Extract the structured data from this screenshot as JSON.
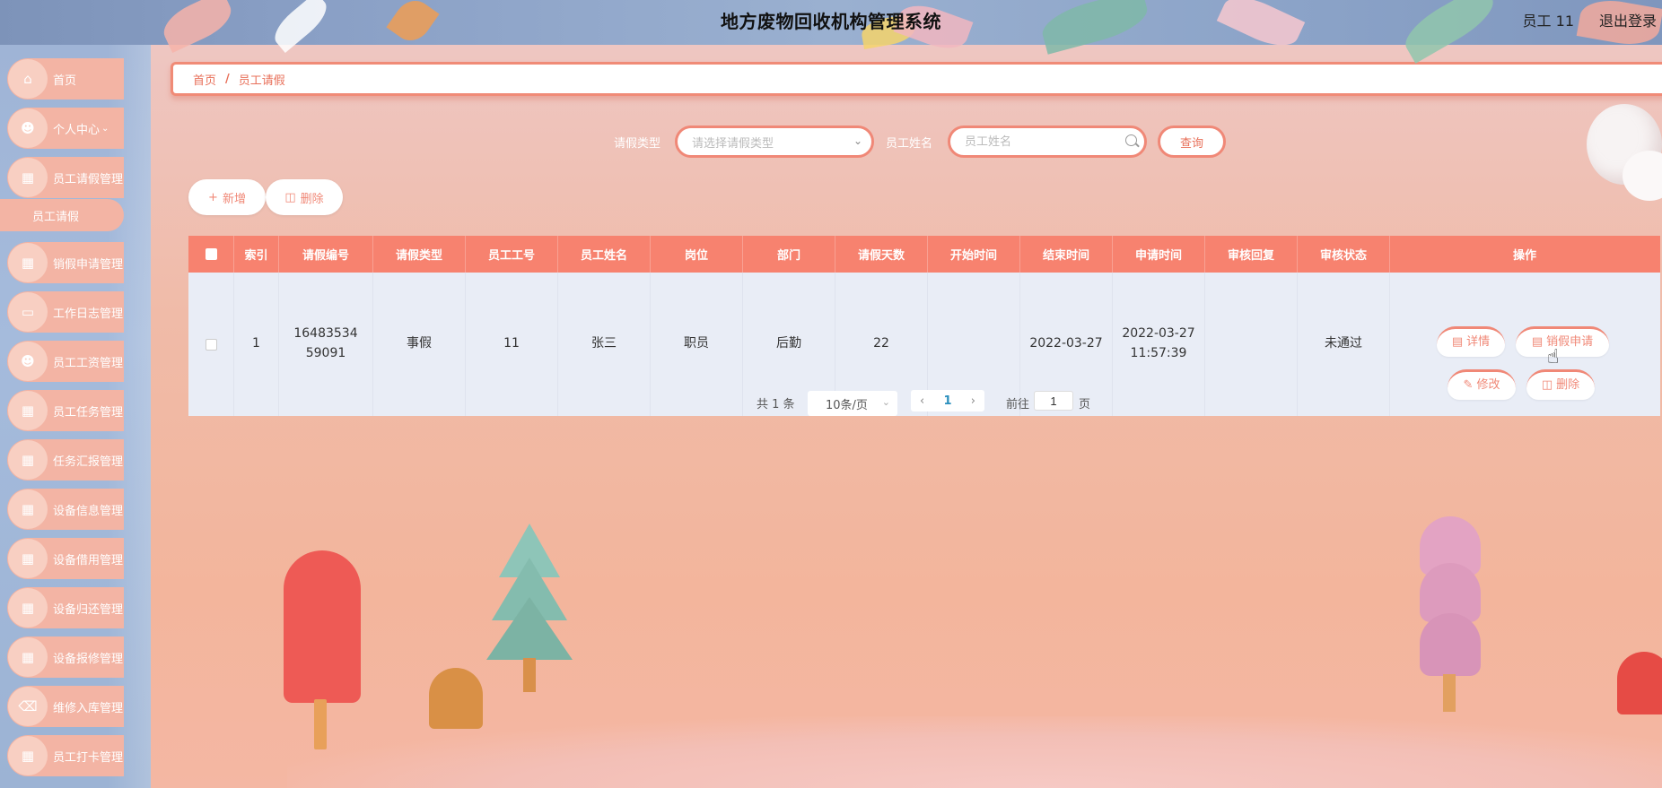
{
  "header": {
    "title": "地方废物回收机构管理系统",
    "user": "员工 11",
    "logout": "退出登录"
  },
  "sidebar": {
    "items": [
      {
        "label": "首页",
        "icon": "home-icon"
      },
      {
        "label": "个人中心",
        "icon": "user-icon"
      },
      {
        "label": "员工请假管理",
        "icon": "clipboard-icon"
      },
      {
        "label": "销假申请管理",
        "icon": "grid-icon"
      },
      {
        "label": "工作日志管理",
        "icon": "monitor-icon"
      },
      {
        "label": "员工工资管理",
        "icon": "user-icon"
      },
      {
        "label": "员工任务管理",
        "icon": "grid-icon"
      },
      {
        "label": "任务汇报管理",
        "icon": "grid-icon"
      },
      {
        "label": "设备信息管理",
        "icon": "grid-icon"
      },
      {
        "label": "设备借用管理",
        "icon": "clipboard-icon"
      },
      {
        "label": "设备归还管理",
        "icon": "grid-icon"
      },
      {
        "label": "设备报修管理",
        "icon": "grid-icon"
      },
      {
        "label": "维修入库管理",
        "icon": "ticket-icon"
      },
      {
        "label": "员工打卡管理",
        "icon": "grid-icon"
      }
    ],
    "sub_item": "员工请假"
  },
  "breadcrumb": {
    "home": "首页",
    "separator": "/",
    "current": "员工请假"
  },
  "search": {
    "type_label": "请假类型",
    "type_placeholder": "请选择请假类型",
    "name_label": "员工姓名",
    "name_placeholder": "员工姓名",
    "query_button": "查询"
  },
  "actions": {
    "add": "新增",
    "delete": "删除"
  },
  "table": {
    "columns": [
      "索引",
      "请假编号",
      "请假类型",
      "员工工号",
      "员工姓名",
      "岗位",
      "部门",
      "请假天数",
      "开始时间",
      "结束时间",
      "申请时间",
      "审核回复",
      "审核状态",
      "操作"
    ],
    "rows": [
      {
        "index": "1",
        "leave_no": "1648353459091",
        "leave_type": "事假",
        "emp_no": "11",
        "emp_name": "张三",
        "post": "职员",
        "dept": "后勤",
        "days": "22",
        "start": "",
        "end": "2022-03-27",
        "applied": "2022-03-27 11:57:39",
        "reply": "",
        "status": "未通过"
      }
    ],
    "row_ops": {
      "detail": "详情",
      "cancel_leave": "销假申请",
      "edit": "修改",
      "delete": "删除"
    }
  },
  "pagination": {
    "total": "共 1 条",
    "page_size": "10条/页",
    "current_page": "1",
    "goto_label": "前往",
    "goto_value": "1",
    "page_unit": "页"
  }
}
